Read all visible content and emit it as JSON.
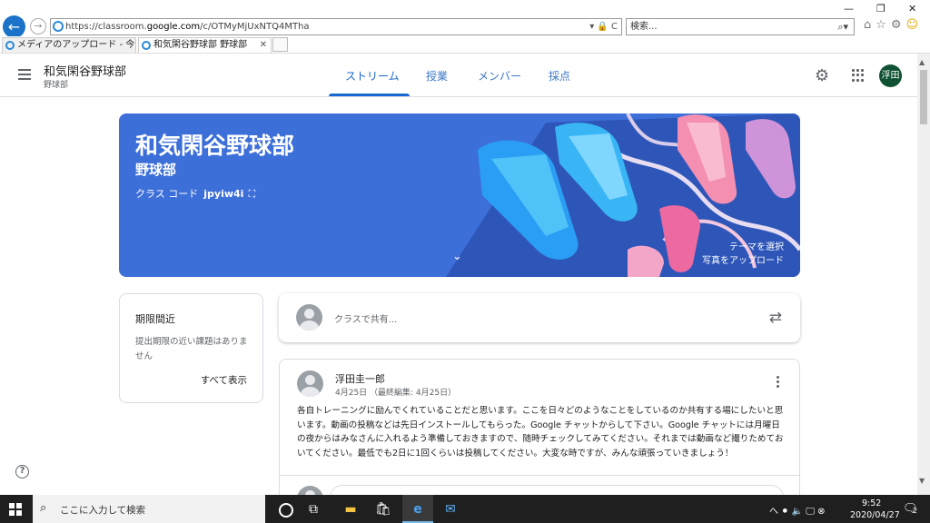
{
  "browser": {
    "url_prefix": "https://classroom.",
    "url_host": "google.com",
    "url_rest": "/c/OTMyMjUxNTQ4MTha",
    "addr_tools": "▾ 🔒 C",
    "search_placeholder": "検索...",
    "tabs": [
      {
        "label": "メディアのアップロード - 今日の！昨..."
      },
      {
        "label": "和気閑谷野球部 野球部"
      }
    ],
    "win_controls": {
      "minimize": "—",
      "restore": "❐",
      "close": "✕"
    },
    "toolbar_icons": "⌂☆⚙"
  },
  "header": {
    "class_name": "和気閑谷野球部",
    "class_section": "野球部",
    "tabs": [
      {
        "label": "ストリーム",
        "active": true
      },
      {
        "label": "授業"
      },
      {
        "label": "メンバー"
      },
      {
        "label": "採点"
      }
    ],
    "user_initials": "浮田"
  },
  "banner": {
    "title": "和気閑谷野球部",
    "subtitle": "野球部",
    "code_label": "クラス コード",
    "code_value": "jpyiw4i",
    "select_theme": "テーマを選択",
    "upload_photo": "写真をアップロード"
  },
  "upcoming": {
    "title": "期限間近",
    "empty_text": "提出期限の近い課題はありません",
    "view_all": "すべて表示"
  },
  "share": {
    "placeholder": "クラスで共有..."
  },
  "post": {
    "author": "浮田圭一郎",
    "date": "4月25日 （最終編集: 4月25日）",
    "body": "各自トレーニングに励んでくれていることだと思います。ここを日々どのようなことをしているのか共有する場にしたいと思います。動画の投稿などは先日インストールしてもらった。Google チャットからして下さい。Google チャットには月曜日の夜からはみなさんに入れるよう準備しておきますので、随時チェックしてみてください。それまでは動画など撮りためておいてください。最低でも2日に1回くらいは投稿してください。大変な時ですが、みんな頑張っていきましょう！"
  },
  "taskbar": {
    "search_text": "ここに入力して検索",
    "clock_time": "9:52",
    "clock_date": "2020/04/27",
    "notification_count": "2",
    "tray_text": "へ ⚫ 🔈 🖵 ⊗"
  },
  "colors": {
    "banner": "#3d6fd9",
    "accent": "#1967d2",
    "avatar": "#0f5132"
  }
}
